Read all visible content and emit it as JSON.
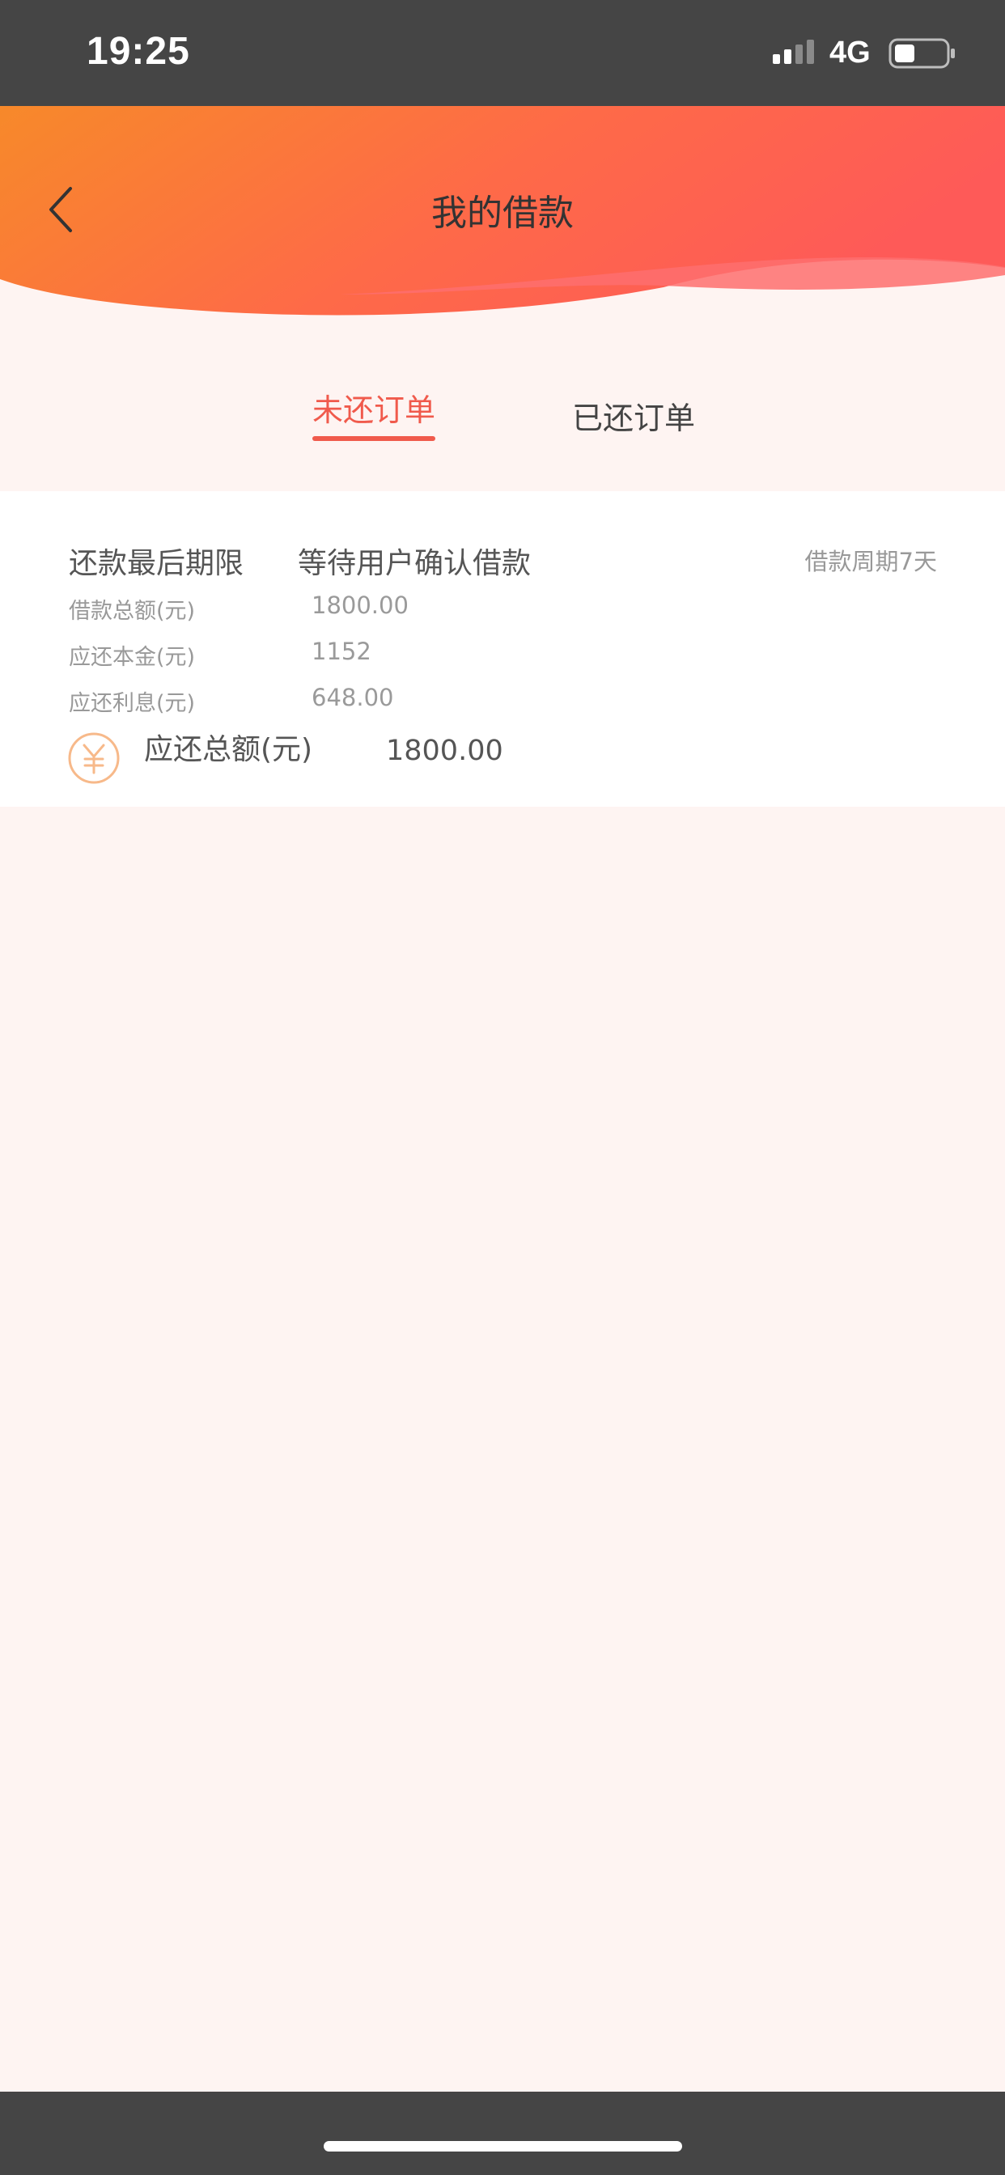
{
  "status_bar": {
    "time": "19:25",
    "network": "4G",
    "icons": [
      "signal-icon",
      "battery-icon"
    ]
  },
  "header": {
    "title": "我的借款",
    "back_icon": "chevron-left-icon",
    "gradient_colors": [
      "#f7892a",
      "#fe5a52"
    ]
  },
  "tabs": [
    {
      "label": "未还订单",
      "active": true
    },
    {
      "label": "已还订单",
      "active": false
    }
  ],
  "order": {
    "deadline_label": "还款最后期限",
    "status": "等待用户确认借款",
    "period": "借款周期7天",
    "rows": [
      {
        "label": "借款总额(元)",
        "value": "1800.00"
      },
      {
        "label": "应还本金(元)",
        "value": "1152"
      },
      {
        "label": "应还利息(元)",
        "value": "648.00"
      }
    ],
    "total_icon": "yuan-icon",
    "total_label": "应还总额(元)",
    "total_value": "1800.00"
  },
  "colors": {
    "accent": "#f05a4c",
    "page_background": "#fef4f2",
    "system_bar": "#454545",
    "yuan_icon": "#f7b98a"
  }
}
